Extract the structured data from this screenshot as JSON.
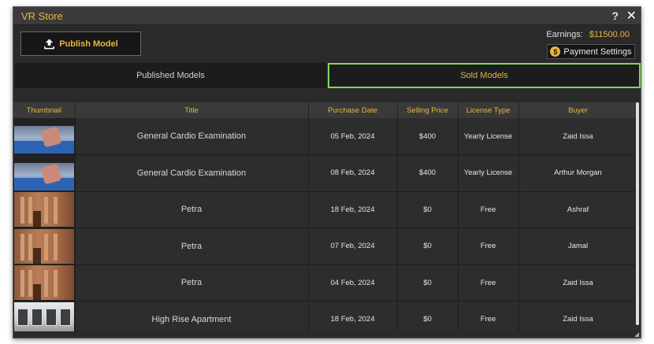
{
  "window": {
    "title": "VR Store",
    "help_label": "?",
    "close_label": "✕"
  },
  "toolbar": {
    "publish_label": "Publish Model",
    "earnings_label": "Earnings:",
    "earnings_amount": "$11500.00",
    "payment_label": "Payment Settings",
    "payment_icon_glyph": "$"
  },
  "tabs": [
    {
      "label": "Published Models",
      "active": false
    },
    {
      "label": "Sold Models",
      "active": true
    }
  ],
  "table": {
    "columns": [
      "Thumbnail",
      "Title",
      "Purchase Date",
      "Selling Price",
      "License Type",
      "Buyer"
    ],
    "rows": [
      {
        "thumb": "cardio",
        "title": "General Cardio Examination",
        "date": "05 Feb, 2024",
        "price": "$400",
        "license": "Yearly License",
        "buyer": "Zaid Issa"
      },
      {
        "thumb": "cardio",
        "title": "General Cardio Examination",
        "date": "08 Feb, 2024",
        "price": "$400",
        "license": "Yearly License",
        "buyer": "Arthur Morgan"
      },
      {
        "thumb": "petra",
        "title": "Petra",
        "date": "18 Feb, 2024",
        "price": "$0",
        "license": "Free",
        "buyer": "Ashraf"
      },
      {
        "thumb": "petra",
        "title": "Petra",
        "date": "07 Feb, 2024",
        "price": "$0",
        "license": "Free",
        "buyer": "Jamal"
      },
      {
        "thumb": "petra",
        "title": "Petra",
        "date": "04 Feb, 2024",
        "price": "$0",
        "license": "Free",
        "buyer": "Zaid Issa"
      },
      {
        "thumb": "apartment",
        "title": "High Rise Apartment",
        "date": "18 Feb, 2024",
        "price": "$0",
        "license": "Free",
        "buyer": "Zaid Issa"
      }
    ]
  },
  "colors": {
    "accent": "#e8b640",
    "active_tab_border": "#7ed957",
    "window_bg": "#2a2a2a"
  }
}
